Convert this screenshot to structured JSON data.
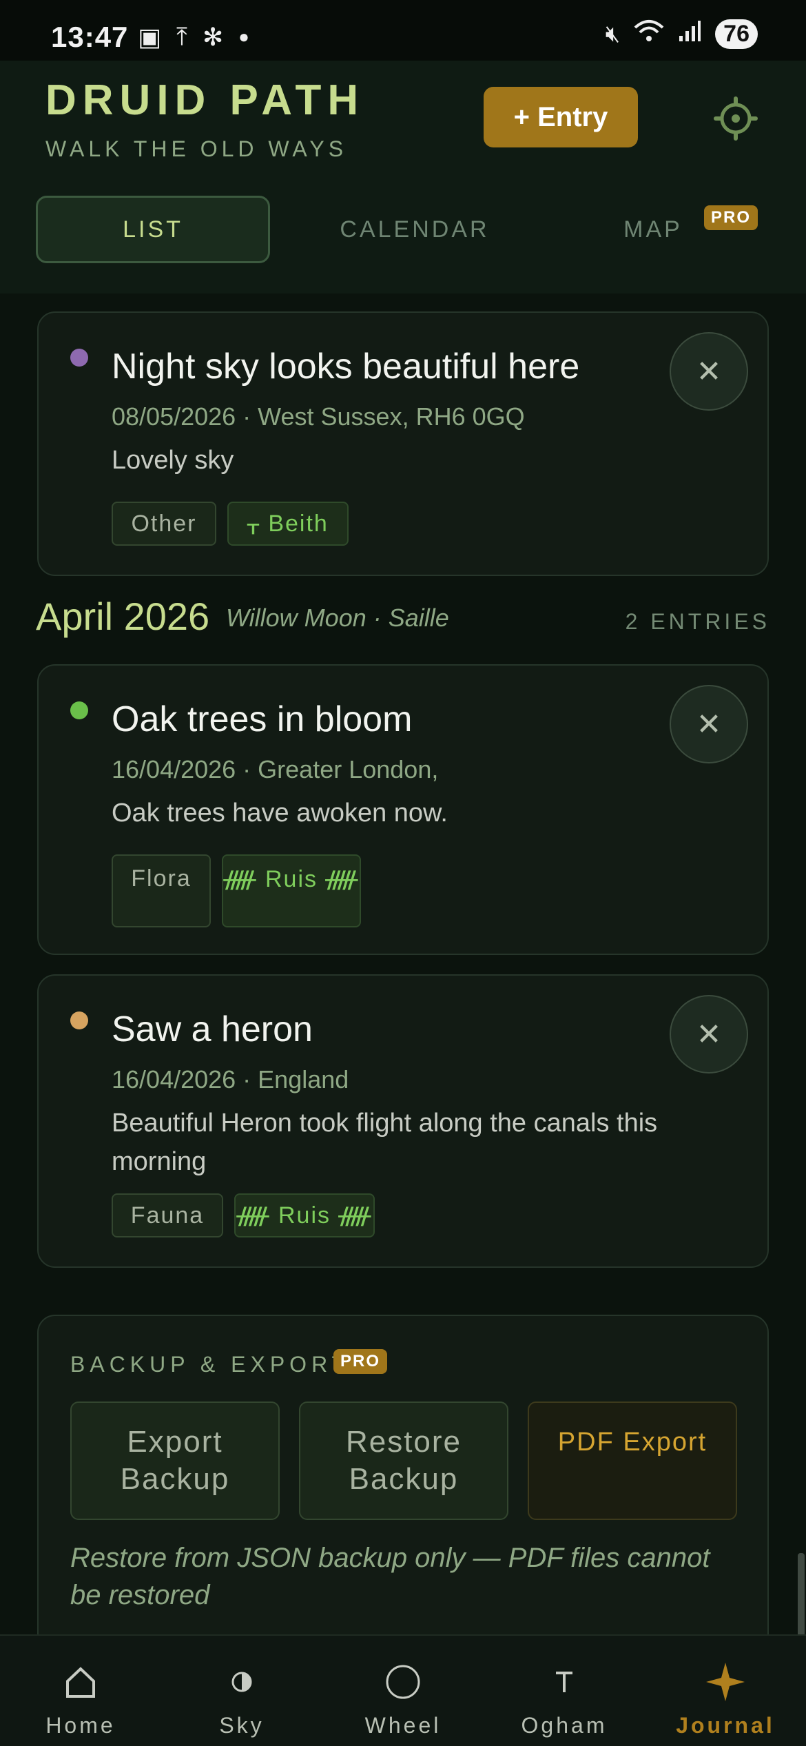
{
  "status_bar": {
    "time": "13:47",
    "battery": "76"
  },
  "header": {
    "title": "DRUID PATH",
    "subtitle": "WALK THE OLD WAYS",
    "entry_button": "+ Entry",
    "tabs": [
      {
        "label": "LIST",
        "active": true
      },
      {
        "label": "CALENDAR",
        "active": false
      },
      {
        "label": "MAP",
        "active": false,
        "badge": "PRO"
      }
    ]
  },
  "entries_top": [
    {
      "title": "Night sky looks beautiful here",
      "meta": "08/05/2026 · West Sussex, RH6 0GQ",
      "body": "Lovely sky",
      "dot_color": "#8e6ab0",
      "tags": [
        "Other",
        "ᚁ Beith"
      ]
    }
  ],
  "month_group": {
    "month": "April 2026",
    "moon": "Willow Moon · Saille",
    "count": "2 ENTRIES",
    "entries": [
      {
        "title": "Oak trees in bloom",
        "meta": "16/04/2026 · Greater London,",
        "body": "Oak trees have awoken now.",
        "dot_color": "#6ac04a",
        "tags": [
          "Flora",
          "ᚏ Ruis ᚏ"
        ]
      },
      {
        "title": "Saw a heron",
        "meta": "16/04/2026 · England",
        "body": "Beautiful Heron took flight along the canals this morning",
        "dot_color": "#d7a460",
        "tags": [
          "Fauna",
          "ᚏ Ruis ᚏ"
        ]
      }
    ]
  },
  "backup": {
    "title": "BACKUP & EXPORT",
    "badge": "PRO",
    "buttons": [
      "Export Backup",
      "Restore Backup",
      "PDF Export"
    ],
    "note": "Restore from JSON backup only — PDF files cannot be restored"
  },
  "bottom_nav": [
    {
      "label": "Home",
      "icon": "home-icon"
    },
    {
      "label": "Sky",
      "icon": "half-moon-icon"
    },
    {
      "label": "Wheel",
      "icon": "circle-icon"
    },
    {
      "label": "Ogham",
      "icon": "ogham-icon"
    },
    {
      "label": "Journal",
      "icon": "star-icon",
      "active": true
    }
  ],
  "colors": {
    "accent": "#a0761a",
    "title_green": "#c7dc8e",
    "background": "#0b130d"
  }
}
